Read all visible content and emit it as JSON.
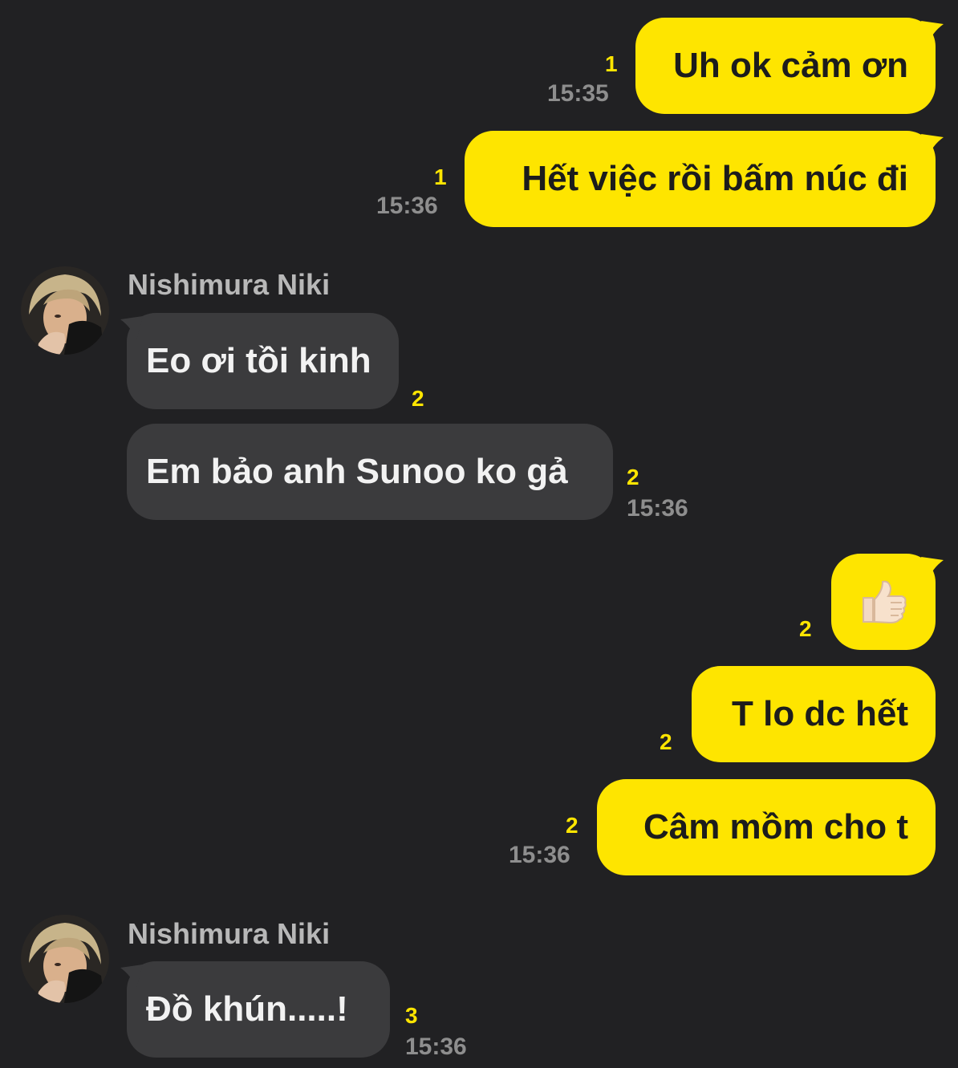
{
  "colors": {
    "background": "#212123",
    "my_bubble": "#fee500",
    "their_bubble": "#3b3b3d",
    "unread_count": "#fee500",
    "timestamp": "#8e8e8e"
  },
  "messages": [
    {
      "from": "me",
      "text": "Uh ok cảm ơn",
      "unread": "1",
      "time": "15:35"
    },
    {
      "from": "me",
      "text": "Hết việc rồi bấm núc đi",
      "unread": "1",
      "time": "15:36"
    },
    {
      "from": "them",
      "sender": "Nishimura Niki",
      "avatar_icon": "profile-photo",
      "text": "Eo ơi tồi kinh",
      "unread": "2"
    },
    {
      "from": "them",
      "text": "Em bảo anh Sunoo ko gả",
      "unread": "2",
      "time": "15:36"
    },
    {
      "from": "me",
      "emoji": "thumbs-up-emoji",
      "text": "👍🏻",
      "unread": "2"
    },
    {
      "from": "me",
      "text": "T lo dc hết",
      "unread": "2"
    },
    {
      "from": "me",
      "text": "Câm mồm cho t",
      "unread": "2",
      "time": "15:36"
    },
    {
      "from": "them",
      "sender": "Nishimura Niki",
      "avatar_icon": "profile-photo",
      "text": "Đồ khún.....!",
      "unread": "3",
      "time": "15:36"
    }
  ]
}
